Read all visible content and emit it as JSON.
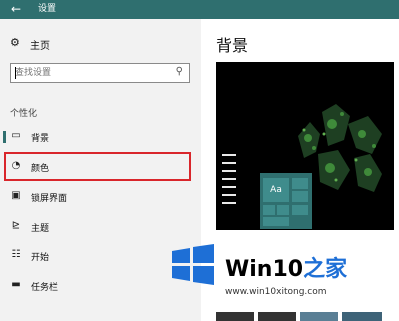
{
  "titlebar": {
    "back_icon": "back-arrow-icon",
    "title": "设置"
  },
  "sidebar": {
    "home": {
      "icon": "gear-icon",
      "label": "主页"
    },
    "search": {
      "placeholder": "查找设置",
      "icon": "search-icon"
    },
    "section_title": "个性化",
    "items": [
      {
        "icon": "image-icon",
        "label": "背景",
        "active": true
      },
      {
        "icon": "palette-icon",
        "label": "颜色",
        "highlighted": true
      },
      {
        "icon": "lock-screen-icon",
        "label": "锁屏界面"
      },
      {
        "icon": "brush-icon",
        "label": "主题"
      },
      {
        "icon": "start-icon",
        "label": "开始"
      },
      {
        "icon": "taskbar-icon",
        "label": "任务栏"
      }
    ]
  },
  "main": {
    "title": "背景",
    "preview": {
      "tile_label": "Aa"
    }
  },
  "watermark": {
    "brand_prefix": "Win10",
    "brand_suffix": "之家",
    "url": "www.win10xitong.com"
  },
  "colors": {
    "accent": "#2f6f6f",
    "highlight_border": "#d9262b",
    "logo_blue": "#1e6fd6"
  }
}
